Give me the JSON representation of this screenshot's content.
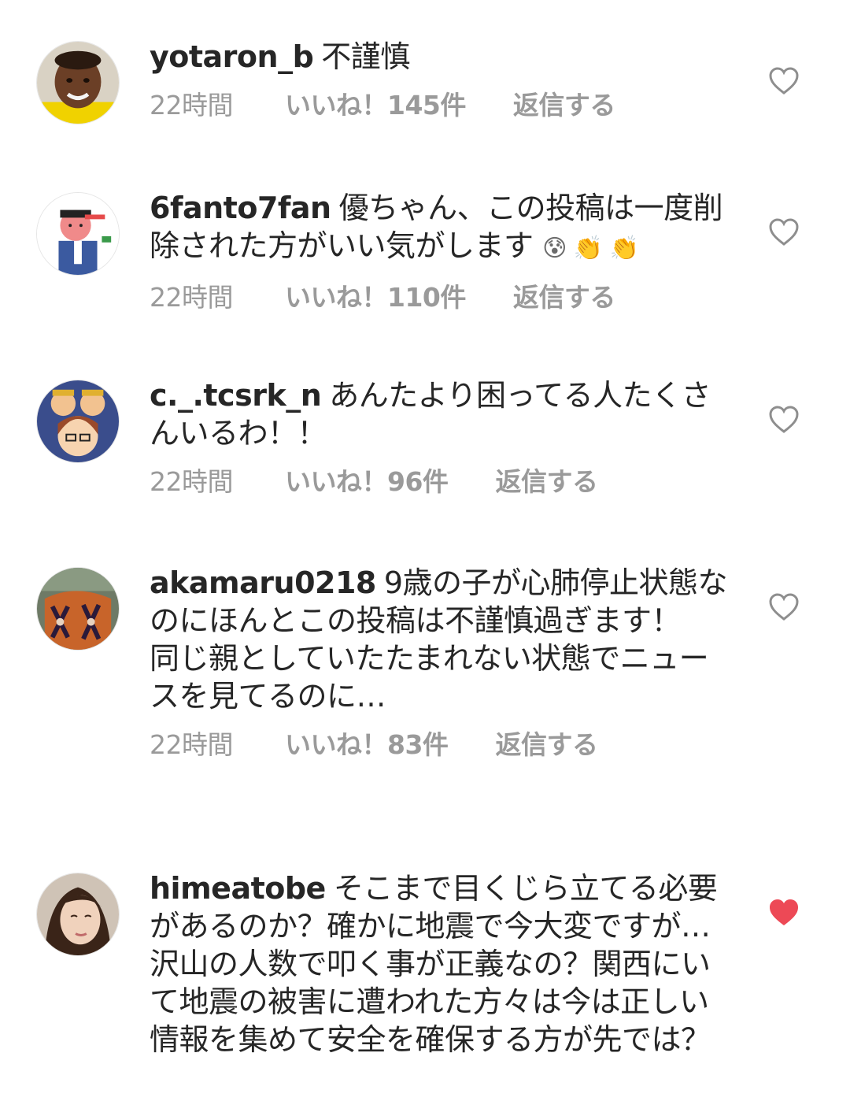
{
  "comments": [
    {
      "username": "yotaron_b",
      "text": "不謹慎",
      "time": "22時間",
      "likes": "いいね！145件",
      "reply": "返信する",
      "liked": false,
      "avatar_icon": "person-yellow-shirt"
    },
    {
      "username": "6fanto7fan",
      "text": "優ちゃん、この投稿は一度削除された方がいい気がします",
      "emoji": "😰 👏 👏",
      "time": "22時間",
      "likes": "いいね！110件",
      "reply": "返信する",
      "liked": false,
      "avatar_icon": "cartoon-salaryman"
    },
    {
      "username": "c._.tcsrk_n",
      "text": "あんたより困ってる人たくさんいるわ！！",
      "time": "22時間",
      "likes": "いいね！96件",
      "reply": "返信する",
      "liked": false,
      "avatar_icon": "cartoon-family"
    },
    {
      "username": "akamaru0218",
      "text": "9歳の子が心肺停止状態なのにほんとこの投稿は不謹慎過ぎます！\n同じ親としていたたまれない状態でニュースを見てるのに…",
      "time": "22時間",
      "likes": "いいね！83件",
      "reply": "返信する",
      "liked": false,
      "avatar_icon": "kimono-pattern"
    },
    {
      "username": "himeatobe",
      "text": "そこまで目くじら立てる必要があるのか？確かに地震で今大変ですが…沢山の人数で叩く事が正義なの？関西にいて地震の被害に遭われた方々は今は正しい情報を集めて安全を確保する方が先では？",
      "time": "",
      "likes": "",
      "reply": "",
      "liked": true,
      "avatar_icon": "woman-portrait"
    }
  ],
  "colors": {
    "heart_liked": "#ed4956",
    "meta": "#9a9a9a",
    "text": "#262626"
  }
}
